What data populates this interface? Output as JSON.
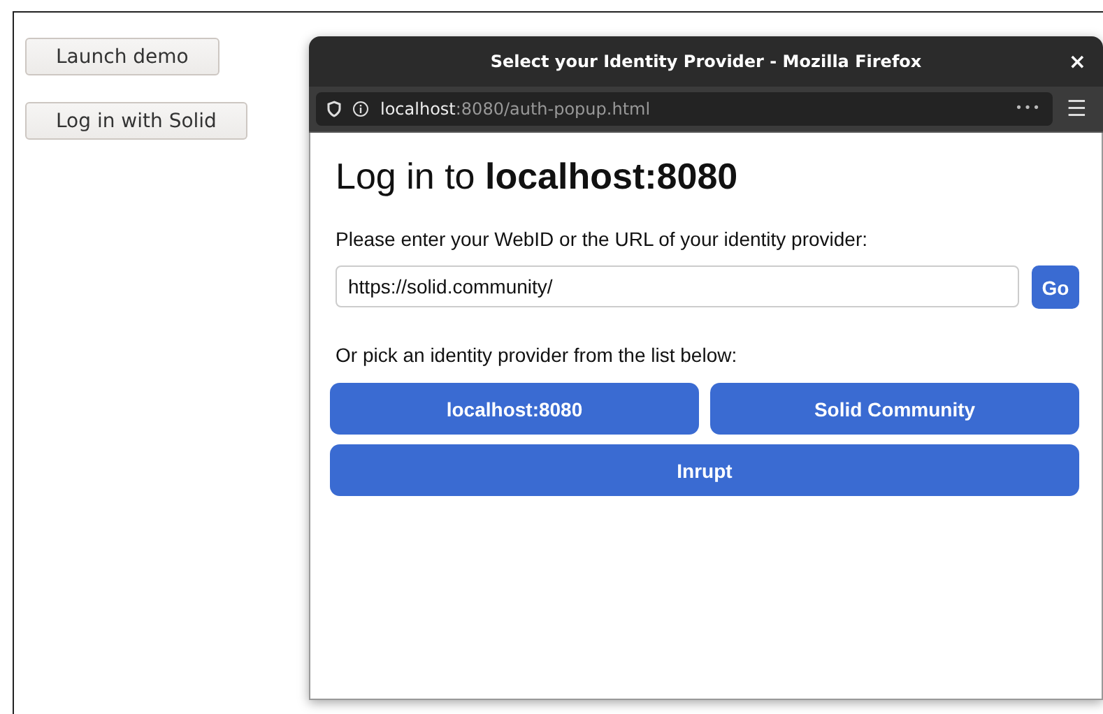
{
  "page_buttons": [
    "Launch demo",
    "Log in with Solid"
  ],
  "popup": {
    "title": "Select your Identity Provider - Mozilla Firefox",
    "close": "×",
    "menu": "☰",
    "more": "•••",
    "url_host": "localhost",
    "url_rest": ":8080/auth-popup.html",
    "heading": "Log in to **localhost:8080**",
    "prompt": "Please enter your WebID or the URL of your identity provider:",
    "input_value": "https://solid.community/",
    "go_button": "Go",
    "list_prompt": "Or pick an identity provider from the list below:",
    "providers": [
      {
        "label": "localhost:8080",
        "kind": "half"
      },
      {
        "label": "Solid Community",
        "kind": "half"
      },
      {
        "label": "Inrupt",
        "kind": "full"
      }
    ]
  }
}
